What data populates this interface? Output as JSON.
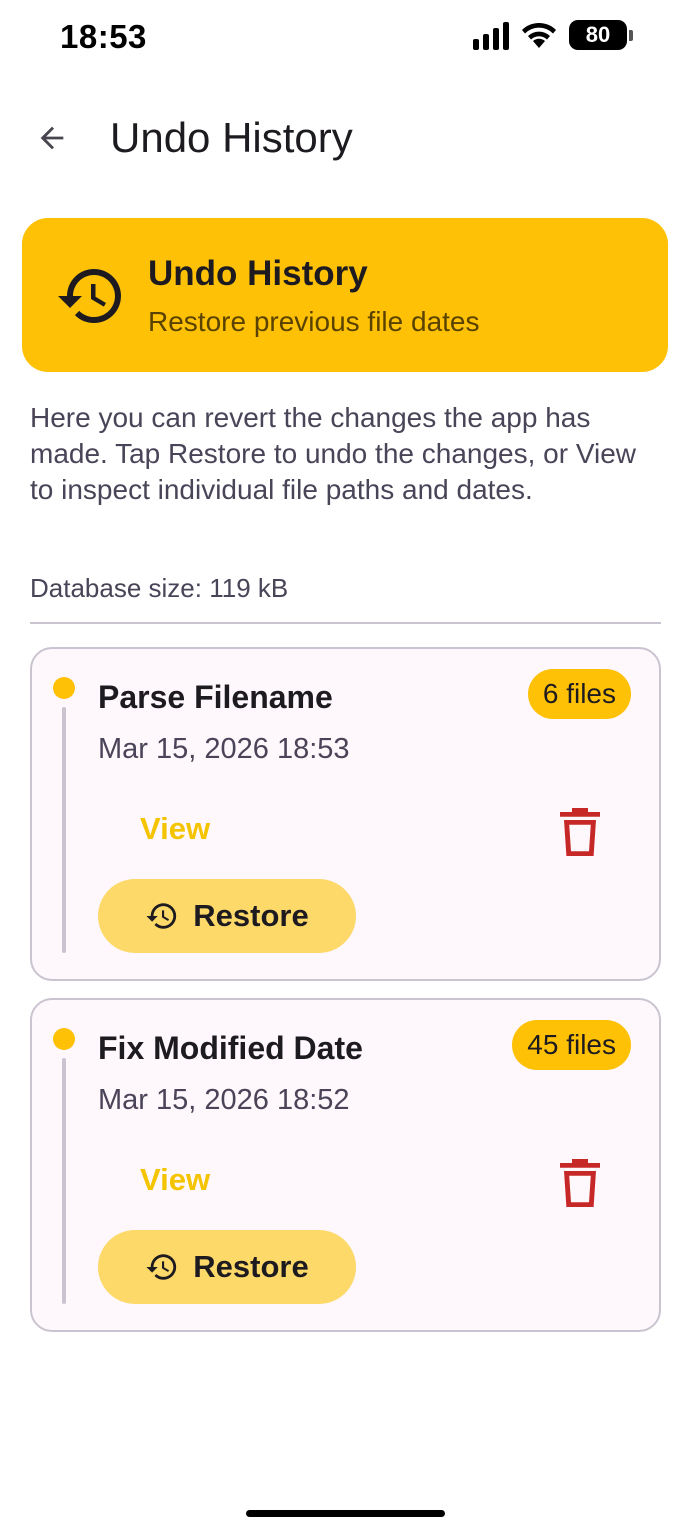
{
  "status_bar": {
    "time": "18:53",
    "battery": "80",
    "icons": [
      "signal-icon",
      "wifi-icon",
      "battery-icon"
    ]
  },
  "app_bar": {
    "back_icon": "arrow-back-icon",
    "title": "Undo History"
  },
  "header_card": {
    "icon": "history-icon",
    "title": "Undo History",
    "subtitle": "Restore previous file dates"
  },
  "description": "Here you can revert the changes the app has made. Tap Restore to undo the changes, or View to inspect individual file paths and dates.",
  "database_size": "Database size: 119 kB",
  "history": [
    {
      "title": "Parse Filename",
      "date": "Mar 15, 2026 18:53",
      "files": "6 files",
      "view_label": "View",
      "restore_label": "Restore",
      "delete_icon": "trash-icon"
    },
    {
      "title": "Fix Modified Date",
      "date": "Mar 15, 2026 18:52",
      "files": "45 files",
      "view_label": "View",
      "restore_label": "Restore",
      "delete_icon": "trash-icon"
    }
  ],
  "colors": {
    "accent": "#fec106",
    "restore_button": "#fdd96a",
    "view_text": "#f5c400",
    "delete": "#c62828",
    "card_background": "#fef7fc",
    "outline": "#cac4d0"
  }
}
